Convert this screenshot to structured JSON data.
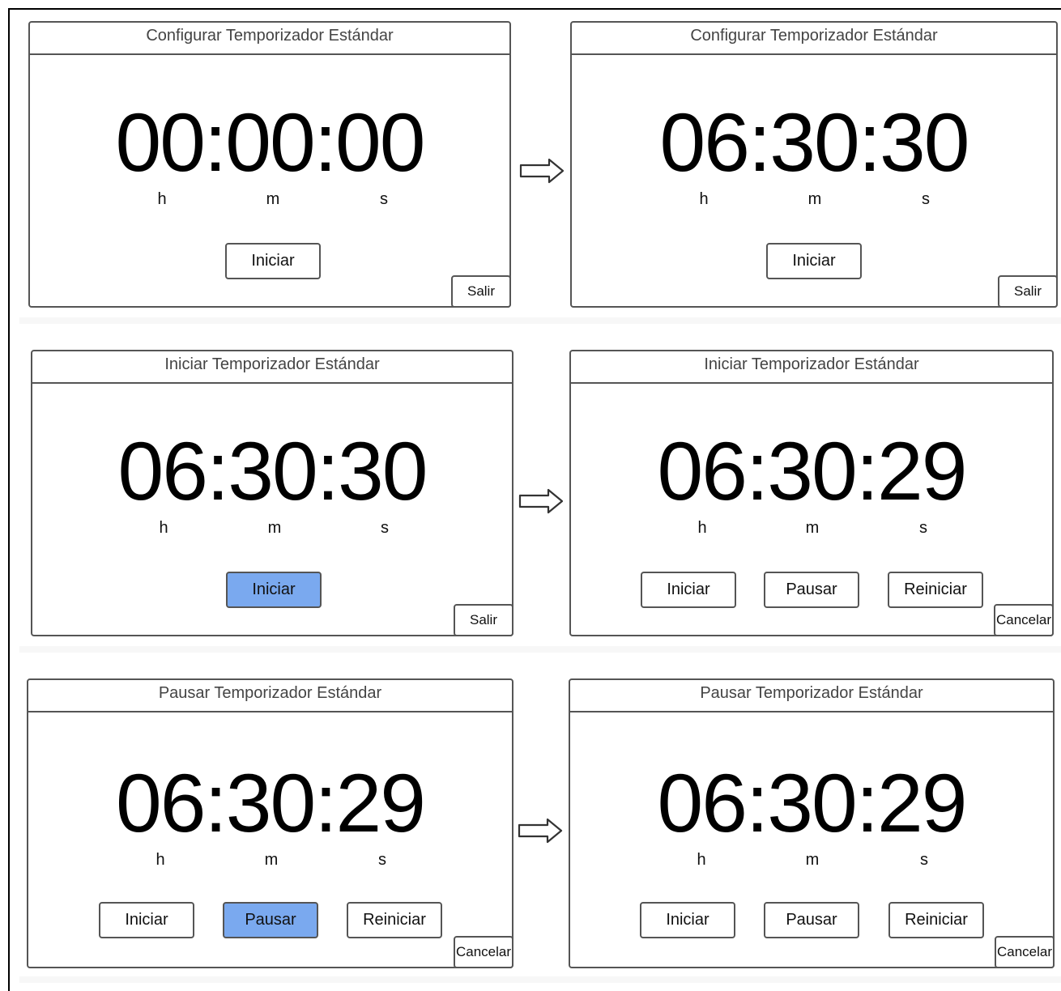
{
  "units": {
    "h": "h",
    "m": "m",
    "s": "s"
  },
  "rows": [
    {
      "left": {
        "title": "Configurar Temporizador Estándar",
        "time": "00:00:00",
        "buttons": [
          "Iniciar"
        ],
        "corner": "Salir"
      },
      "right": {
        "title": "Configurar Temporizador Estándar",
        "time": "06:30:30",
        "buttons": [
          "Iniciar"
        ],
        "corner": "Salir"
      }
    },
    {
      "left": {
        "title": "Iniciar Temporizador Estándar",
        "time": "06:30:30",
        "buttons": [
          "Iniciar"
        ],
        "active_button": "Iniciar",
        "corner": "Salir"
      },
      "right": {
        "title": "Iniciar Temporizador Estándar",
        "time": "06:30:29",
        "buttons": [
          "Iniciar",
          "Pausar",
          "Reiniciar"
        ],
        "corner": "Cancelar"
      }
    },
    {
      "left": {
        "title": "Pausar Temporizador Estándar",
        "time": "06:30:29",
        "buttons": [
          "Iniciar",
          "Pausar",
          "Reiniciar"
        ],
        "active_button": "Pausar",
        "corner": "Cancelar"
      },
      "right": {
        "title": "Pausar Temporizador Estándar",
        "time": "06:30:29",
        "buttons": [
          "Iniciar",
          "Pausar",
          "Reiniciar"
        ],
        "corner": "Cancelar"
      }
    }
  ],
  "colors": {
    "active_button": "#7aa9ef",
    "border": "#555555",
    "arrow": "#333333"
  },
  "icons": {
    "flow_arrow": "right-arrow-icon"
  }
}
